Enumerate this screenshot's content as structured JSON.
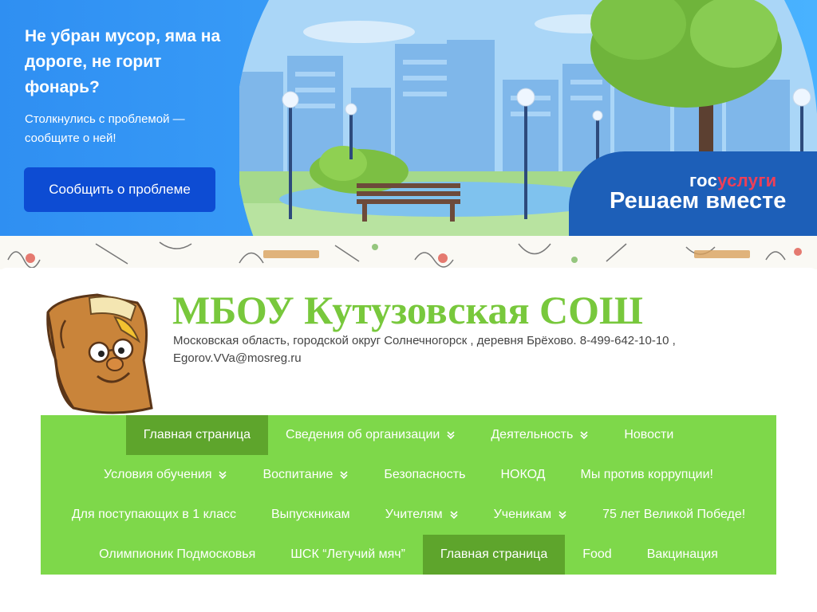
{
  "banner": {
    "title": "Не убран мусор, яма на дороге, не горит фонарь?",
    "subtitle": "Столкнулись с проблемой — сообщите о ней!",
    "button_label": "Сообщить о проблеме",
    "brand_logo_part1": "гос",
    "brand_logo_part2": "услуги",
    "brand_tagline": "Решаем вместе"
  },
  "school": {
    "title": "МБОУ Кутузовская СОШ",
    "contacts": "Московская область, городской округ Солнечногорск , деревня Брёхово. 8-499-642-10-10 , Egorov.VVa@mosreg.ru"
  },
  "nav": {
    "rows": [
      [
        {
          "label": "Главная страница",
          "active": true,
          "dropdown": false
        },
        {
          "label": "Сведения об организации",
          "active": false,
          "dropdown": true
        },
        {
          "label": "Деятельность",
          "active": false,
          "dropdown": true
        },
        {
          "label": "Новости",
          "active": false,
          "dropdown": false
        }
      ],
      [
        {
          "label": "Условия обучения",
          "active": false,
          "dropdown": true
        },
        {
          "label": "Воспитание",
          "active": false,
          "dropdown": true
        },
        {
          "label": "Безопасность",
          "active": false,
          "dropdown": false
        },
        {
          "label": "НОКОД",
          "active": false,
          "dropdown": false
        },
        {
          "label": "Мы против коррупции!",
          "active": false,
          "dropdown": false
        }
      ],
      [
        {
          "label": "Для поступающих в 1 класс",
          "active": false,
          "dropdown": false
        },
        {
          "label": "Выпускникам",
          "active": false,
          "dropdown": false
        },
        {
          "label": "Учителям",
          "active": false,
          "dropdown": true
        },
        {
          "label": "Ученикам",
          "active": false,
          "dropdown": true
        },
        {
          "label": "75 лет Великой Победе!",
          "active": false,
          "dropdown": false
        }
      ],
      [
        {
          "label": "Олимпионик Подмосковья",
          "active": false,
          "dropdown": false
        },
        {
          "label": "ШСК “Летучий мяч”",
          "active": false,
          "dropdown": false
        },
        {
          "label": "Главная страница",
          "active": true,
          "dropdown": false
        },
        {
          "label": "Food",
          "active": false,
          "dropdown": false
        },
        {
          "label": "Вакцинация",
          "active": false,
          "dropdown": false
        }
      ]
    ]
  },
  "colors": {
    "banner_blue": "#2f8ff2",
    "button_blue": "#0d4cd3",
    "brand_red": "#ee3f58",
    "school_green": "#78c83c",
    "nav_green": "#7ed84a",
    "nav_active": "#5ea52c"
  },
  "icons": [
    "chevron-down-icon",
    "park-illustration",
    "book-mascot"
  ]
}
